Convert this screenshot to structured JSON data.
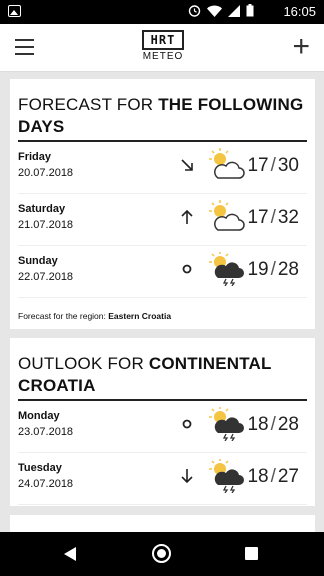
{
  "status": {
    "time": "16:05"
  },
  "app": {
    "logo_text": "HRT",
    "logo_sub": "METEO"
  },
  "colors": {
    "sun": "#f4c542",
    "cloud": "#333333",
    "accent": "#222222"
  },
  "card1": {
    "title_light": "FORECAST FOR ",
    "title_bold": "THE FOLLOWING DAYS",
    "rows": [
      {
        "day": "Friday",
        "date": "20.07.2018",
        "wind_icon": "arrow-down-right-icon",
        "weather_icon": "sun-cloud-icon",
        "min": "17",
        "sep": "/",
        "max": "30"
      },
      {
        "day": "Saturday",
        "date": "21.07.2018",
        "wind_icon": "arrow-up-icon",
        "weather_icon": "sun-cloud-icon",
        "min": "17",
        "sep": "/",
        "max": "32"
      },
      {
        "day": "Sunday",
        "date": "22.07.2018",
        "wind_icon": "calm-circle-icon",
        "weather_icon": "sun-storm-cloud-icon",
        "min": "19",
        "sep": "/",
        "max": "28"
      }
    ],
    "region_label": "Forecast for the region: ",
    "region_name": "Eastern Croatia"
  },
  "card2": {
    "title_light": "OUTLOOK FOR ",
    "title_bold": "CONTINENTAL CROATIA",
    "rows": [
      {
        "day": "Monday",
        "date": "23.07.2018",
        "wind_icon": "calm-circle-icon",
        "weather_icon": "sun-storm-cloud-icon",
        "min": "18",
        "sep": "/",
        "max": "28"
      },
      {
        "day": "Tuesday",
        "date": "24.07.2018",
        "wind_icon": "arrow-down-icon",
        "weather_icon": "sun-storm-cloud-icon",
        "min": "18",
        "sep": "/",
        "max": "27"
      }
    ]
  }
}
